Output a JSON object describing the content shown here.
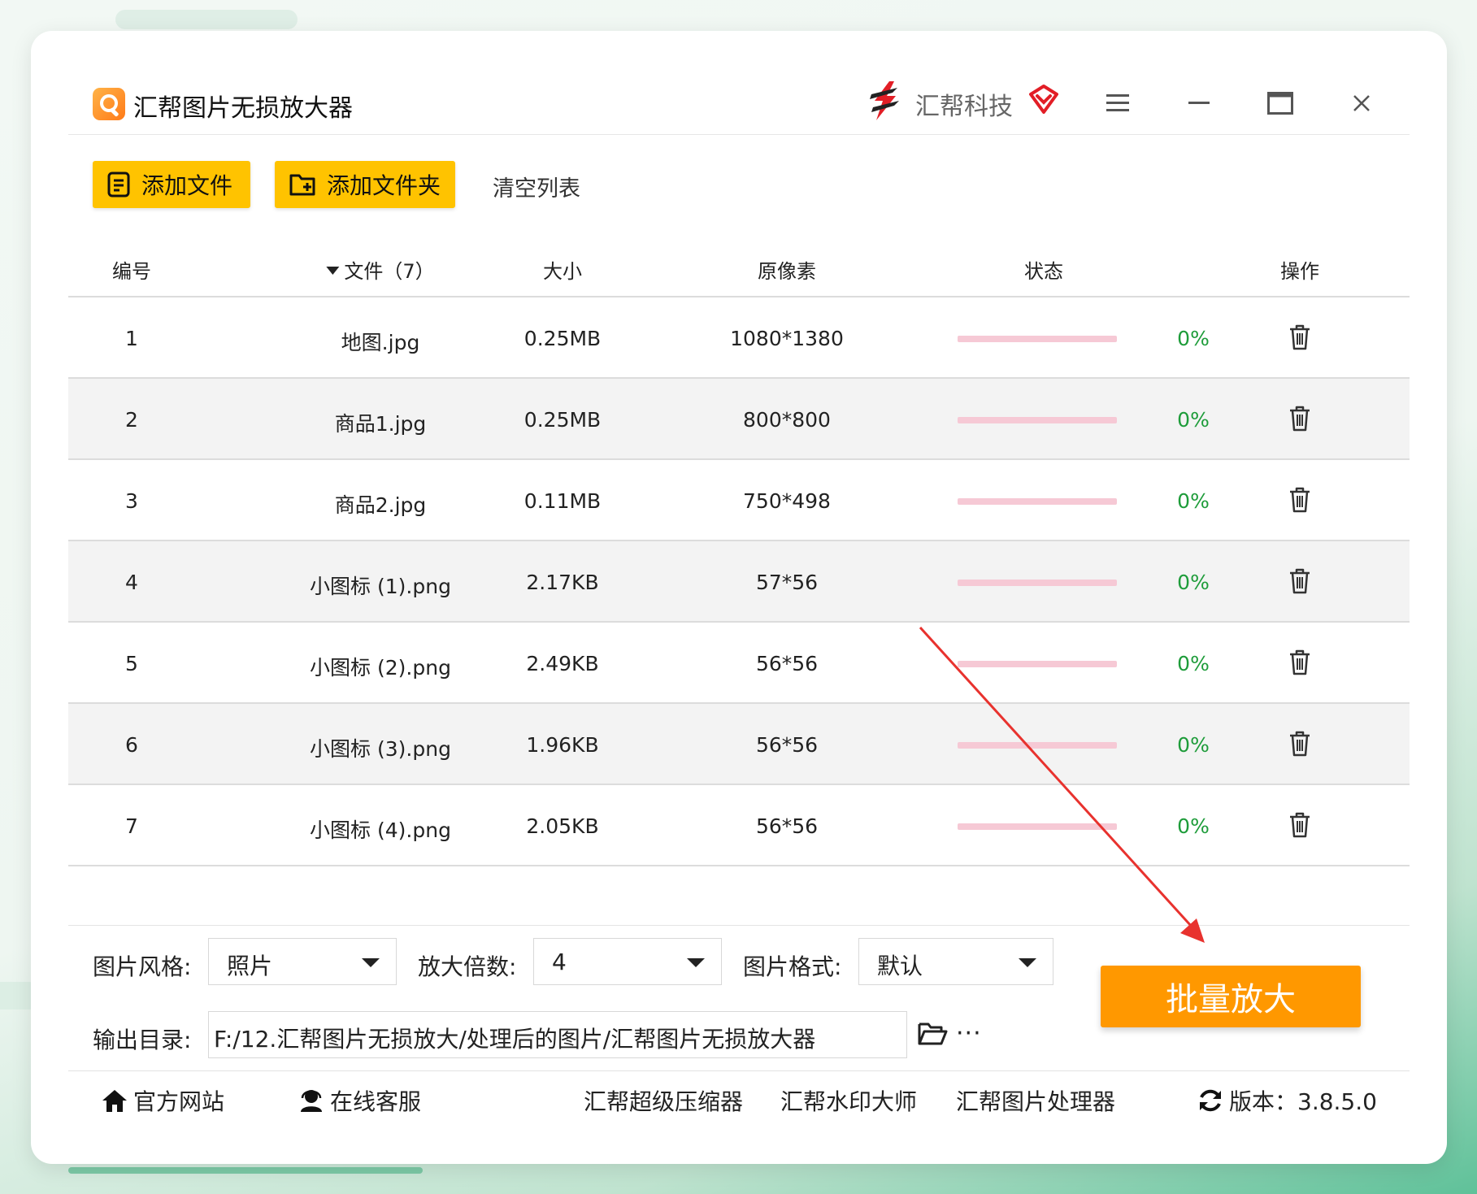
{
  "window": {
    "title": "汇帮图片无损放大器",
    "brand": "汇帮科技"
  },
  "toolbar": {
    "add_file": "添加文件",
    "add_folder": "添加文件夹",
    "clear_list": "清空列表"
  },
  "table": {
    "headers": {
      "index": "编号",
      "file": "文件（7）",
      "size": "大小",
      "pixels": "原像素",
      "status": "状态",
      "action": "操作"
    },
    "rows": [
      {
        "index": "1",
        "file": "地图.jpg",
        "size": "0.25MB",
        "pixels": "1080*1380",
        "progress": "0%"
      },
      {
        "index": "2",
        "file": "商品1.jpg",
        "size": "0.25MB",
        "pixels": "800*800",
        "progress": "0%"
      },
      {
        "index": "3",
        "file": "商品2.jpg",
        "size": "0.11MB",
        "pixels": "750*498",
        "progress": "0%"
      },
      {
        "index": "4",
        "file": "小图标 (1).png",
        "size": "2.17KB",
        "pixels": "57*56",
        "progress": "0%"
      },
      {
        "index": "5",
        "file": "小图标 (2).png",
        "size": "2.49KB",
        "pixels": "56*56",
        "progress": "0%"
      },
      {
        "index": "6",
        "file": "小图标 (3).png",
        "size": "1.96KB",
        "pixels": "56*56",
        "progress": "0%"
      },
      {
        "index": "7",
        "file": "小图标 (4).png",
        "size": "2.05KB",
        "pixels": "56*56",
        "progress": "0%"
      }
    ]
  },
  "settings": {
    "style_label": "图片风格:",
    "style_value": "照片",
    "scale_label": "放大倍数:",
    "scale_value": "4",
    "format_label": "图片格式:",
    "format_value": "默认",
    "output_label": "输出目录:",
    "output_value": "F:/12.汇帮图片无损放大/处理后的图片/汇帮图片无损放大器",
    "more": "···"
  },
  "actions": {
    "batch_enlarge": "批量放大"
  },
  "footer": {
    "official_site": "官方网站",
    "online_service": "在线客服",
    "compressor": "汇帮超级压缩器",
    "watermark": "汇帮水印大师",
    "image_processor": "汇帮图片处理器",
    "version": "版本：3.8.5.0"
  },
  "colors": {
    "accent_yellow": "#ffc300",
    "batch_orange": "#ff9800",
    "progress_track": "#f6c9d5",
    "percent_green": "#1e9c3a",
    "annotation_red": "#e8322e"
  },
  "icons": {
    "menu": "hamburger-icon",
    "minimize": "minimize-icon",
    "maximize": "maximize-icon",
    "close": "close-icon",
    "delete": "trash-icon",
    "folder": "folder-open-icon",
    "home": "home-icon",
    "support": "headset-icon",
    "refresh": "refresh-icon"
  }
}
